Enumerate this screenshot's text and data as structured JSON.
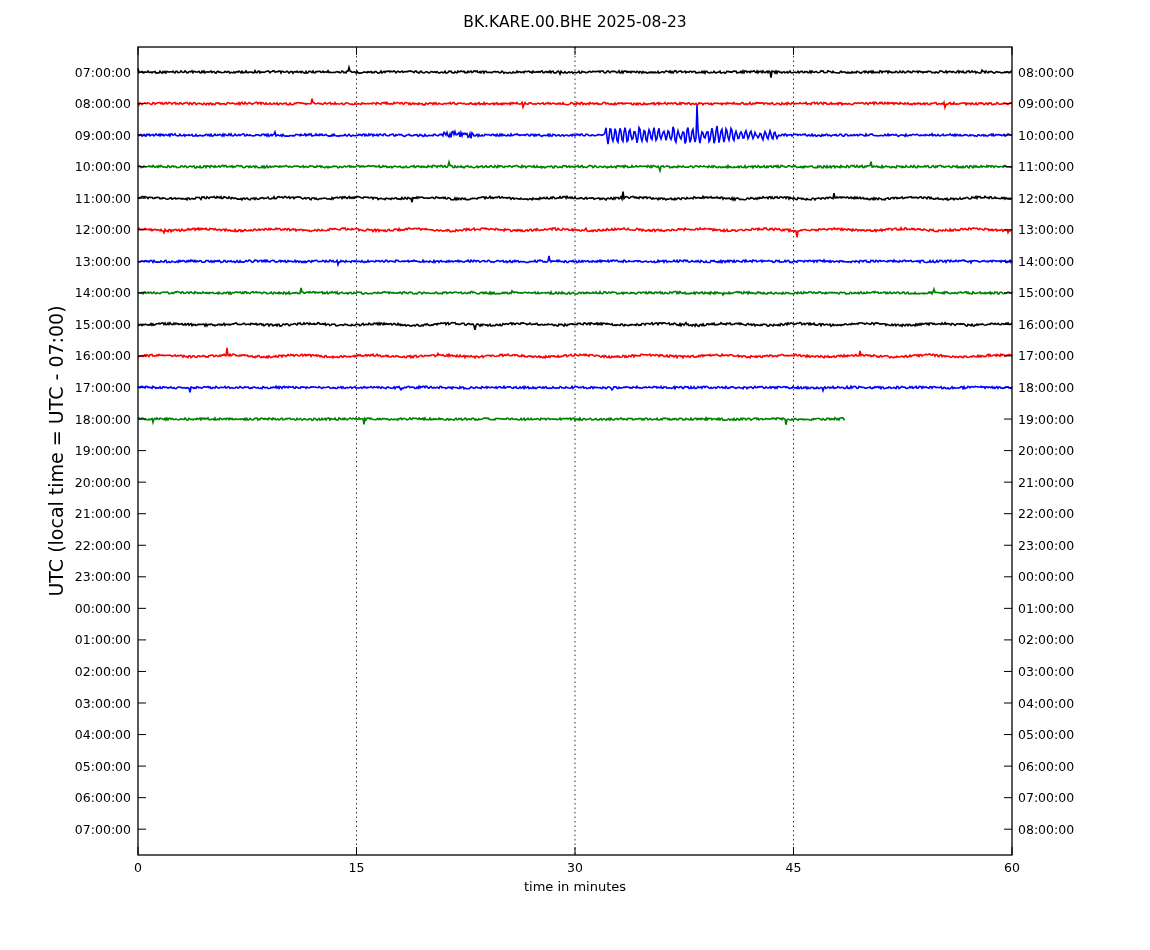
{
  "title": "BK.KARE.00.BHE 2025-08-23",
  "ylabel": "UTC (local time = UTC - 07:00)",
  "xlabel": "time in minutes",
  "xticks": [
    "0",
    "15",
    "30",
    "45",
    "60"
  ],
  "left_labels": [
    "07:00:00",
    "08:00:00",
    "09:00:00",
    "10:00:00",
    "11:00:00",
    "12:00:00",
    "13:00:00",
    "14:00:00",
    "15:00:00",
    "16:00:00",
    "17:00:00",
    "18:00:00",
    "19:00:00",
    "20:00:00",
    "21:00:00",
    "22:00:00",
    "23:00:00",
    "00:00:00",
    "01:00:00",
    "02:00:00",
    "03:00:00",
    "04:00:00",
    "05:00:00",
    "06:00:00",
    "07:00:00"
  ],
  "right_labels": [
    "08:00:00",
    "09:00:00",
    "10:00:00",
    "11:00:00",
    "12:00:00",
    "13:00:00",
    "14:00:00",
    "15:00:00",
    "16:00:00",
    "17:00:00",
    "18:00:00",
    "19:00:00",
    "20:00:00",
    "21:00:00",
    "22:00:00",
    "23:00:00",
    "00:00:00",
    "01:00:00",
    "02:00:00",
    "03:00:00",
    "04:00:00",
    "05:00:00",
    "06:00:00",
    "07:00:00",
    "08:00:00"
  ],
  "traces": [
    {
      "color": "#000000",
      "kind": "full"
    },
    {
      "color": "#ff0000",
      "kind": "full"
    },
    {
      "color": "#0000ff",
      "kind": "full"
    },
    {
      "color": "#008000",
      "kind": "full"
    },
    {
      "color": "#000000",
      "kind": "full"
    },
    {
      "color": "#ff0000",
      "kind": "full"
    },
    {
      "color": "#0000ff",
      "kind": "full"
    },
    {
      "color": "#008000",
      "kind": "full"
    },
    {
      "color": "#000000",
      "kind": "full"
    },
    {
      "color": "#ff0000",
      "kind": "full"
    },
    {
      "color": "#0000ff",
      "kind": "full"
    },
    {
      "color": "#008000",
      "kind": "partial"
    }
  ]
}
